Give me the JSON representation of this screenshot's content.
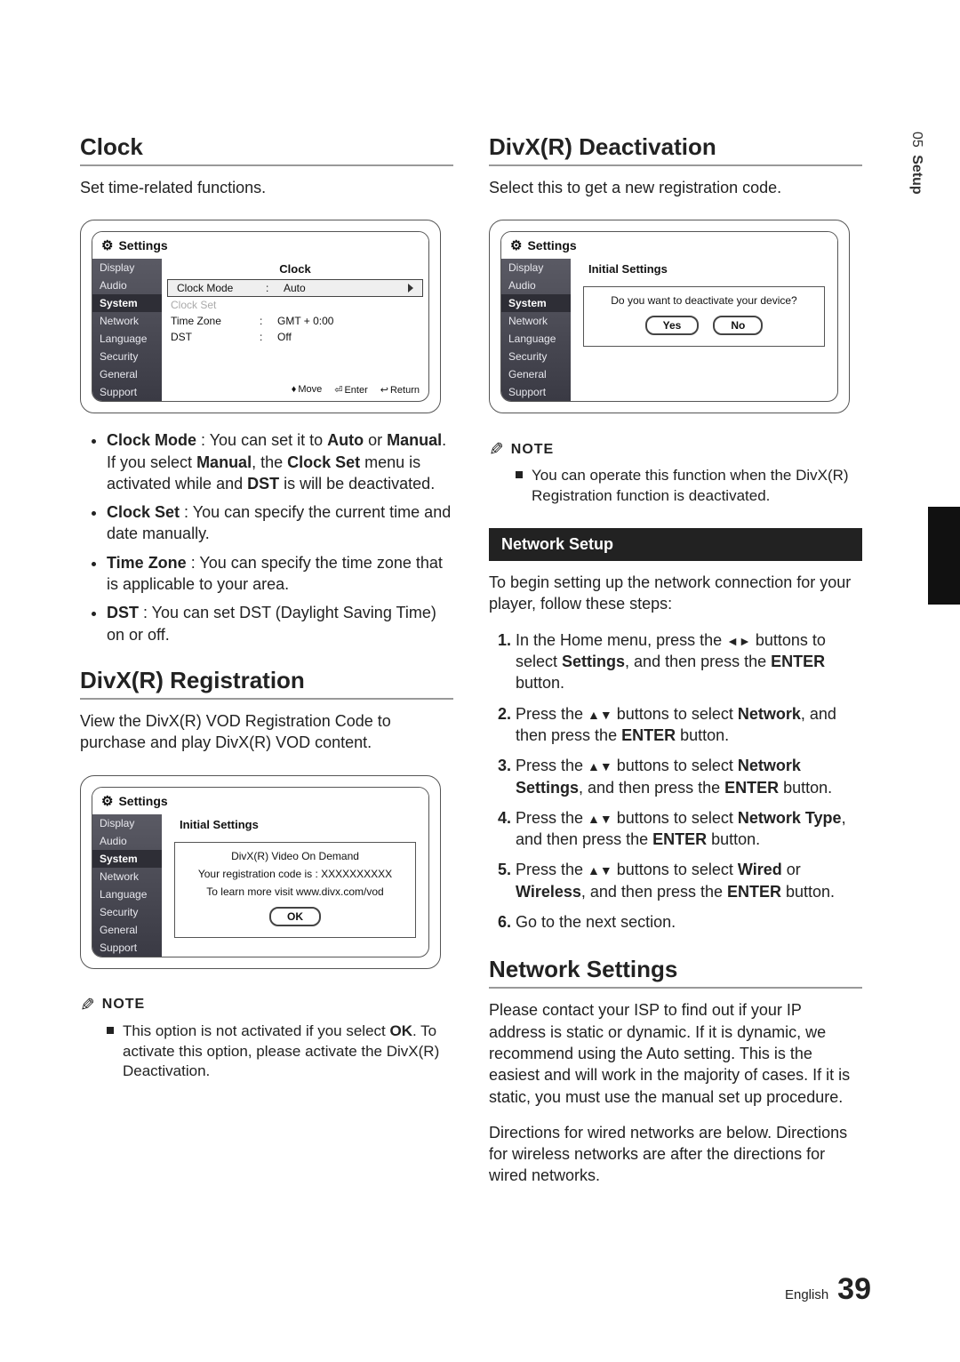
{
  "sideTab": {
    "page": "05",
    "label": "Setup"
  },
  "left": {
    "clock": {
      "title": "Clock",
      "intro": "Set time-related functions.",
      "osd": {
        "settings": "Settings",
        "menu": [
          "Display",
          "Audio",
          "System",
          "Network",
          "Language",
          "Security",
          "General",
          "Support"
        ],
        "panelTitle": "Clock",
        "rows": [
          {
            "label": "Clock Mode",
            "value": "Auto",
            "sel": true
          },
          {
            "label": "Clock Set",
            "value": "",
            "disabled": true
          },
          {
            "label": "Time Zone",
            "value": "GMT + 0:00"
          },
          {
            "label": "DST",
            "value": "Off"
          }
        ],
        "footer": {
          "move": "Move",
          "enter": "Enter",
          "return": "Return"
        }
      },
      "bullets": [
        {
          "bold1": "Clock Mode",
          "rest": " : You can set it to ",
          "bold2": "Auto",
          "rest2": " or ",
          "bold3": "Manual",
          "rest3": ".",
          "sub": [
            "If you select ",
            "Manual",
            ", the ",
            "Clock Set",
            " menu is activated while and ",
            "DST",
            " is will be deactivated."
          ]
        },
        {
          "bold1": "Clock Set",
          "rest": " : You can specify the current time and date manually."
        },
        {
          "bold1": "Time Zone",
          "rest": " : You can specify the time zone that is applicable to your area."
        },
        {
          "bold1": "DST",
          "rest": " : You can set DST (Daylight Saving Time) on or off."
        }
      ]
    },
    "divxReg": {
      "title": "DivX(R) Registration",
      "intro": "View the DivX(R) VOD Registration Code to purchase and play DivX(R) VOD content.",
      "osd": {
        "settings": "Settings",
        "menu": [
          "Display",
          "Audio",
          "System",
          "Network",
          "Language",
          "Security",
          "General",
          "Support"
        ],
        "panelTitle": "Initial Settings",
        "dialog": {
          "line1": "DivX(R) Video On Demand",
          "line2": "Your registration code is : XXXXXXXXXX",
          "line3": "To learn more visit www.divx.com/vod",
          "ok": "OK"
        }
      },
      "noteLabel": "NOTE",
      "noteText": [
        "This option is not activated if you select ",
        "OK",
        ". To activate this option, please activate the DivX(R) Deactivation."
      ]
    }
  },
  "right": {
    "divxDeact": {
      "title": "DivX(R) Deactivation",
      "intro": "Select this to get a new registration code.",
      "osd": {
        "settings": "Settings",
        "menu": [
          "Display",
          "Audio",
          "System",
          "Network",
          "Language",
          "Security",
          "General",
          "Support"
        ],
        "panelTitle": "Initial Settings",
        "dialog": {
          "prompt": "Do you want to deactivate your device?",
          "yes": "Yes",
          "no": "No"
        }
      },
      "noteLabel": "NOTE",
      "noteText": "You can operate this function when the DivX(R) Registration function is deactivated."
    },
    "networkSetup": {
      "bar": "Network Setup",
      "intro": "To begin setting up the network connection for your player, follow these steps:",
      "steps": [
        {
          "pre": "In the Home menu, press the ",
          "dir": "◄►",
          "post1": " buttons to select ",
          "b1": "Settings",
          "post2": ", and then press the ",
          "b2": "ENTER",
          "post3": " button."
        },
        {
          "pre": "Press the ",
          "dir": "▲▼",
          "post1": " buttons to select ",
          "b1": "Network",
          "post2": ", and then press the ",
          "b2": "ENTER",
          "post3": " button."
        },
        {
          "pre": "Press the ",
          "dir": "▲▼",
          "post1": " buttons to select ",
          "b1": "Network Settings",
          "post2": ", and then press the ",
          "b2": "ENTER",
          "post3": " button."
        },
        {
          "pre": "Press the ",
          "dir": "▲▼",
          "post1": " buttons to select ",
          "b1": "Network Type",
          "post2": ", and then press the ",
          "b2": "ENTER",
          "post3": " button."
        },
        {
          "pre": "Press the ",
          "dir": "▲▼",
          "post1": " buttons to select ",
          "b1": "Wired",
          "mid": " or ",
          "b1b": "Wireless",
          "post2": ", and then press the ",
          "b2": "ENTER",
          "post3": " button."
        },
        {
          "pre": "Go to the next section."
        }
      ]
    },
    "networkSettings": {
      "title": "Network Settings",
      "p1": "Please contact your ISP to find out if your IP address is static or dynamic. If it is dynamic, we recommend using the Auto setting. This is the easiest and will work in the majority of cases. If it is static, you must use the manual set up procedure.",
      "p2": "Directions for wired networks are below. Directions for wireless networks are after the directions for wired networks."
    }
  },
  "footer": {
    "lang": "English",
    "page": "39"
  }
}
